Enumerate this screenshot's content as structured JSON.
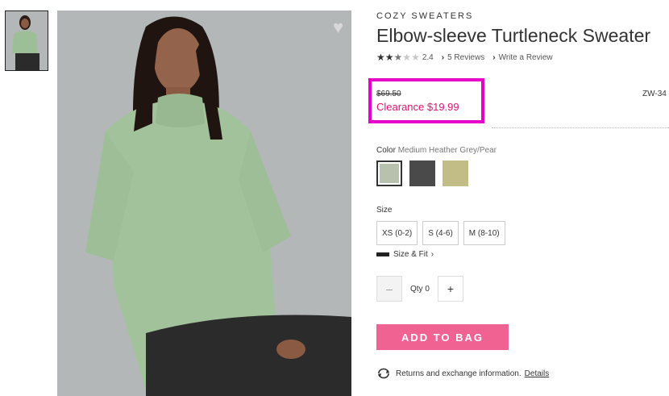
{
  "product": {
    "brand": "COZY SWEATERS",
    "title": "Elbow-sleeve Turtleneck Sweater",
    "rating_value": "2.4",
    "rating_stars": 2.5,
    "reviews_link": "5 Reviews",
    "write_review_link": "Write a Review",
    "original_price": "$69.50",
    "clearance_price": "Clearance $19.99",
    "sku": "ZW-34"
  },
  "color": {
    "label": "Color",
    "selected_value": "Medium Heather Grey/Pear",
    "swatches": [
      {
        "color": "#b8c0ae"
      },
      {
        "color": "#4a4a4a"
      },
      {
        "color": "#c2bd86"
      }
    ]
  },
  "size": {
    "label": "Size",
    "options": [
      "XS (0-2)",
      "S (4-6)",
      "M (8-10)"
    ],
    "size_fit_link": "Size & Fit"
  },
  "quantity": {
    "label": "Qty",
    "value": "0"
  },
  "actions": {
    "add_to_bag": "ADD TO BAG"
  },
  "returns": {
    "text": "Returns and exchange information.",
    "details_link": "Details"
  },
  "icons": {
    "heart": "heart-icon",
    "ruler": "ruler-icon",
    "returns": "returns-icon"
  },
  "colors": {
    "accent_pink": "#f06292",
    "clearance_red": "#e2136e",
    "highlight_magenta": "#e600c9"
  }
}
